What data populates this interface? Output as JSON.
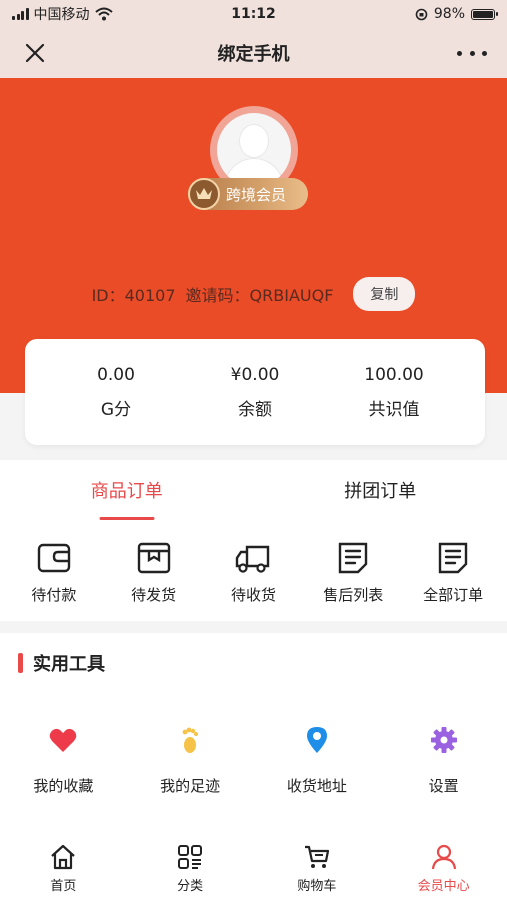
{
  "status_bar": {
    "carrier": "中国移动",
    "time": "11:12",
    "battery_percent": "98%",
    "battery_level": 0.98
  },
  "nav": {
    "title": "绑定手机",
    "close_icon": "close-icon",
    "more_icon": "more-icon"
  },
  "profile": {
    "vip_label": "跨境会员",
    "id_text": "ID：40107",
    "invite_text": "邀请码：QRBIAUQF",
    "copy_label": "复制"
  },
  "stats": [
    {
      "value": "0.00",
      "label": "G分"
    },
    {
      "value": "¥0.00",
      "label": "余额"
    },
    {
      "value": "100.00",
      "label": "共识值"
    }
  ],
  "orders": {
    "tabs": [
      {
        "label": "商品订单",
        "active": true
      },
      {
        "label": "拼团订单",
        "active": false
      }
    ],
    "items": [
      {
        "label": "待付款",
        "icon": "wallet-icon"
      },
      {
        "label": "待发货",
        "icon": "box-icon"
      },
      {
        "label": "待收货",
        "icon": "truck-icon"
      },
      {
        "label": "售后列表",
        "icon": "document-icon"
      },
      {
        "label": "全部订单",
        "icon": "document-icon"
      }
    ]
  },
  "tools": {
    "title": "实用工具",
    "items": [
      {
        "label": "我的收藏",
        "icon": "heart-icon"
      },
      {
        "label": "我的足迹",
        "icon": "footprint-icon"
      },
      {
        "label": "收货地址",
        "icon": "location-icon"
      },
      {
        "label": "设置",
        "icon": "gear-icon"
      }
    ]
  },
  "tab_bar": [
    {
      "label": "首页",
      "icon": "home-icon",
      "active": false
    },
    {
      "label": "分类",
      "icon": "category-icon",
      "active": false
    },
    {
      "label": "购物车",
      "icon": "cart-icon",
      "active": false
    },
    {
      "label": "会员中心",
      "icon": "user-icon",
      "active": true
    }
  ],
  "colors": {
    "hero_bg": "#ea4c27",
    "accent": "#e84a4a",
    "nav_bg": "#f0e1dc"
  }
}
